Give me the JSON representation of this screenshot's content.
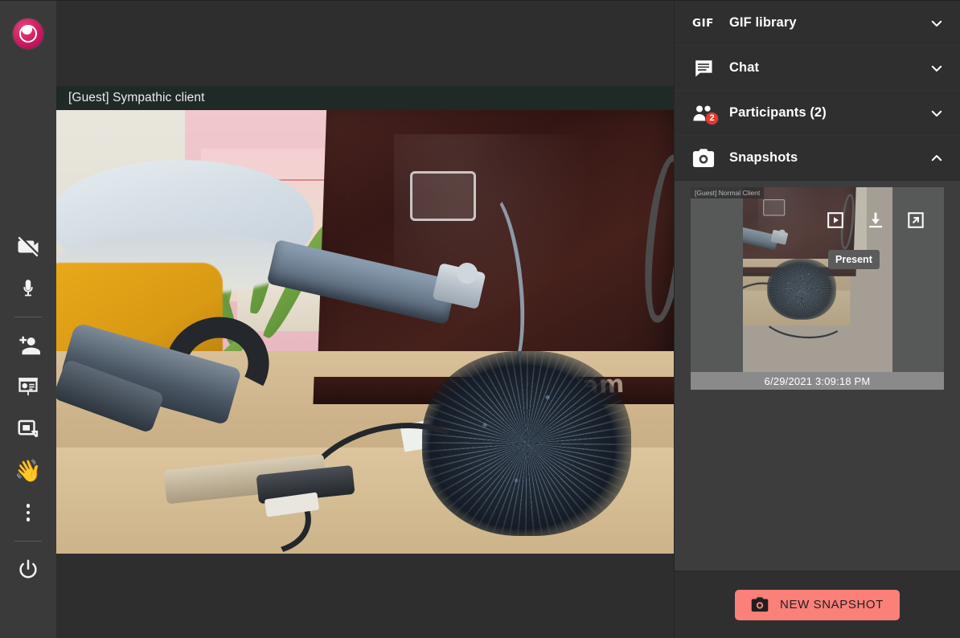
{
  "app": {
    "logo_icon": "app-logo-circle",
    "background_color": "#2b2b2b",
    "accent_color": "#fa8079",
    "badge_color": "#e8392c"
  },
  "rail": {
    "items": [
      {
        "name": "camera-off",
        "icon": "video-off-icon",
        "label": "Camera off"
      },
      {
        "name": "microphone",
        "icon": "microphone-icon",
        "label": "Microphone"
      },
      {
        "name": "invite",
        "icon": "person-add-icon",
        "label": "Invite"
      },
      {
        "name": "present",
        "icon": "presentation-icon",
        "label": "Present"
      },
      {
        "name": "picture-in-picture",
        "icon": "picture-in-picture-icon",
        "label": "Picture in picture"
      },
      {
        "name": "raise-hand",
        "icon": "waving-hand-emoji",
        "label": "Wave",
        "glyph": "👋"
      },
      {
        "name": "more-options",
        "icon": "more-vertical-icon",
        "label": "More options"
      },
      {
        "name": "leave-call",
        "icon": "power-icon",
        "label": "Leave"
      }
    ]
  },
  "stage": {
    "participant_name": "[Guest] Sympathic client"
  },
  "panel": {
    "sections": [
      {
        "key": "gif",
        "title": "GIF library",
        "icon": "gif-icon",
        "expanded": false,
        "chevron": "chevron-down-icon"
      },
      {
        "key": "chat",
        "title": "Chat",
        "icon": "chat-bubble-icon",
        "expanded": false,
        "chevron": "chevron-down-icon"
      },
      {
        "key": "participants",
        "title": "Participants (2)",
        "icon": "participants-icon",
        "expanded": false,
        "chevron": "chevron-down-icon",
        "badge": "2"
      },
      {
        "key": "snapshots",
        "title": "Snapshots",
        "icon": "camera-icon",
        "expanded": true,
        "chevron": "chevron-up-icon"
      }
    ],
    "snapshots": {
      "items": [
        {
          "source_label": "[Guest] Normal Client",
          "timestamp": "6/29/2021 3:09:18 PM",
          "actions": [
            {
              "name": "present-snapshot",
              "icon": "present-play-box-icon",
              "tooltip": "Present"
            },
            {
              "name": "download-snapshot",
              "icon": "download-icon"
            },
            {
              "name": "open-snapshot-new-tab",
              "icon": "open-in-new-icon"
            }
          ]
        }
      ],
      "tooltip_visible": "Present"
    },
    "footer": {
      "new_snapshot_label": "NEW SNAPSHOT",
      "new_snapshot_icon": "camera-icon"
    }
  }
}
